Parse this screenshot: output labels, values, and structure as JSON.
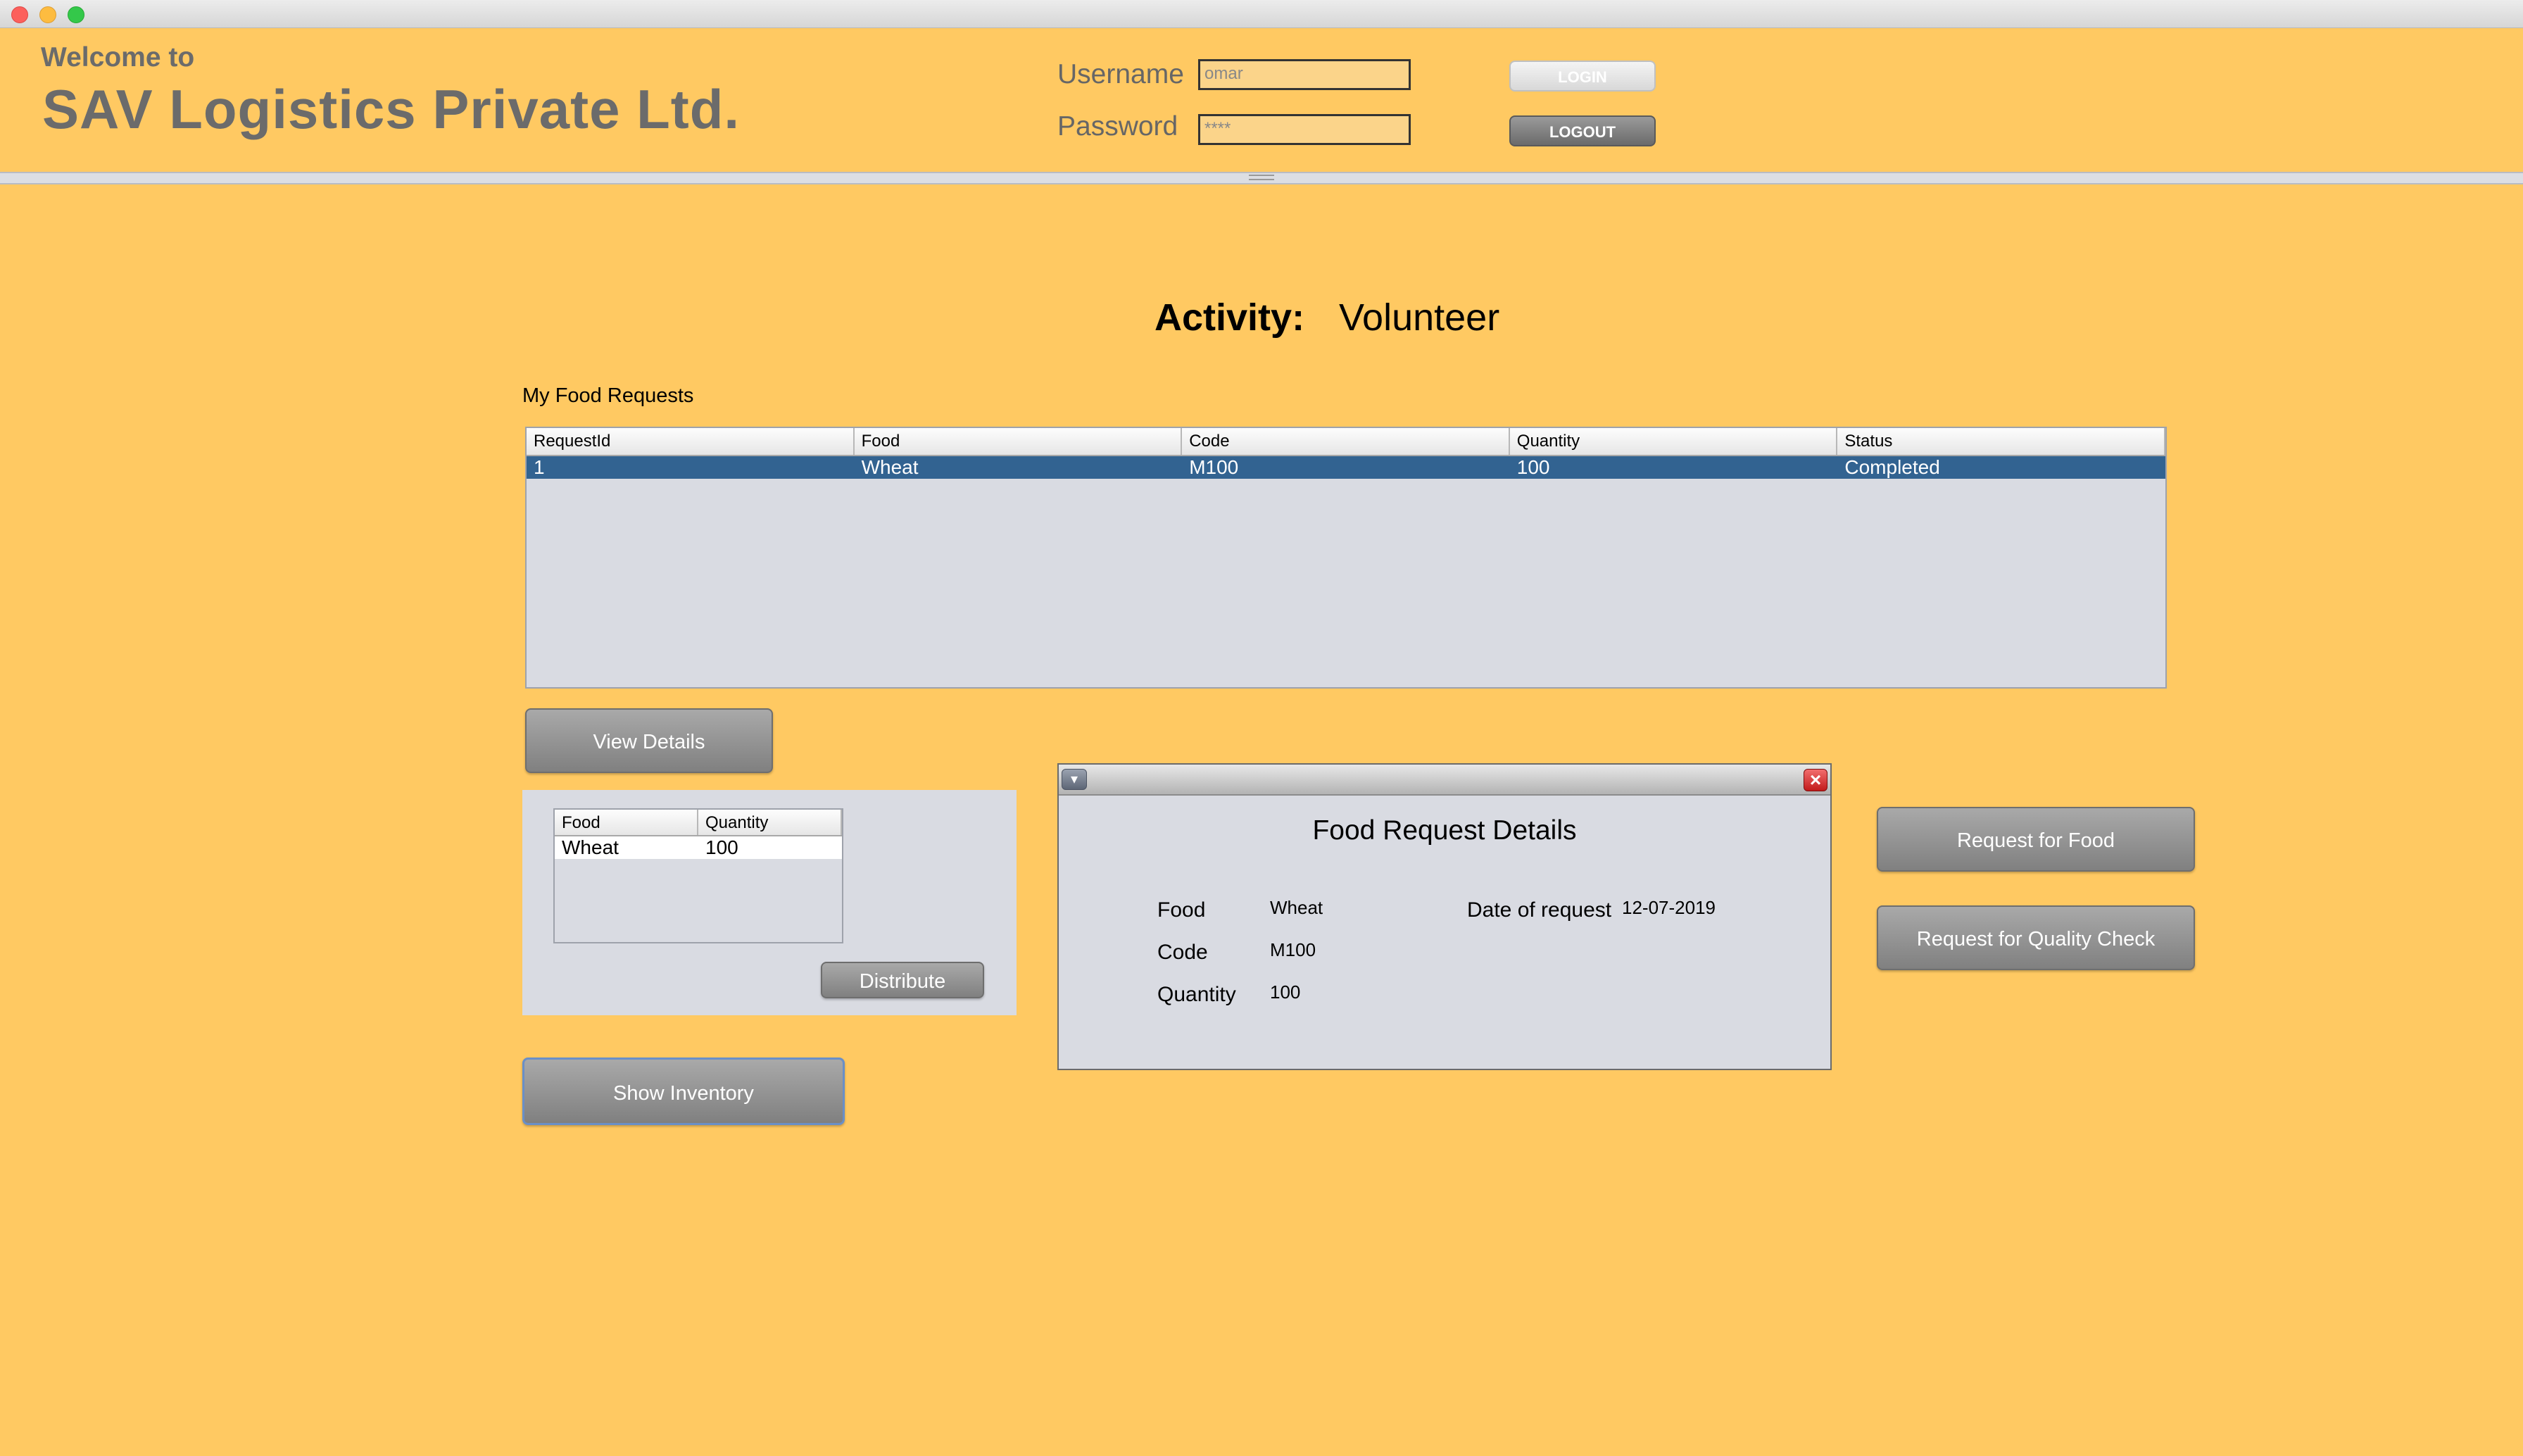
{
  "header": {
    "welcome": "Welcome to",
    "company": "SAV Logistics Private Ltd.",
    "username_label": "Username",
    "password_label": "Password",
    "username_value": "omar",
    "password_value": "****",
    "login_label": "LOGIN",
    "logout_label": "LOGOUT"
  },
  "activity": {
    "label": "Activity:",
    "value": "Volunteer"
  },
  "requests": {
    "title": "My Food Requests",
    "columns": [
      "RequestId",
      "Food",
      "Code",
      "Quantity",
      "Status"
    ],
    "rows": [
      [
        "1",
        "Wheat",
        "M100",
        "100",
        "Completed"
      ]
    ]
  },
  "buttons": {
    "view_details": "View Details",
    "distribute": "Distribute",
    "show_inventory": "Show Inventory",
    "request_food": "Request for Food",
    "request_quality": "Request for Quality Check"
  },
  "inventory": {
    "columns": [
      "Food",
      "Quantity"
    ],
    "rows": [
      [
        "Wheat",
        "100"
      ]
    ]
  },
  "details": {
    "title": "Food Request Details",
    "food_label": "Food",
    "food_value": "Wheat",
    "code_label": "Code",
    "code_value": "M100",
    "quantity_label": "Quantity",
    "quantity_value": "100",
    "date_label": "Date of request",
    "date_value": "12-07-2019"
  },
  "colors": {
    "background": "#ffc962",
    "selection": "#326391"
  }
}
